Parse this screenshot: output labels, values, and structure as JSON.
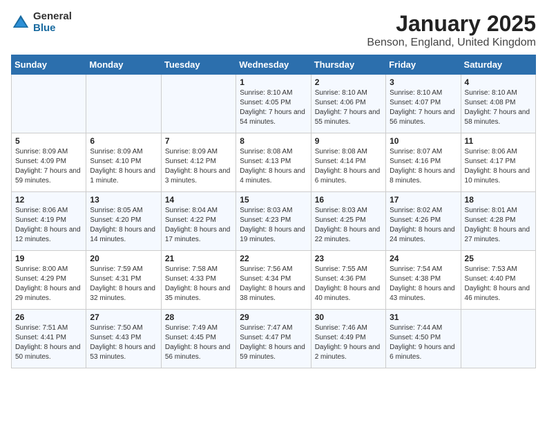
{
  "logo": {
    "general": "General",
    "blue": "Blue"
  },
  "title": "January 2025",
  "subtitle": "Benson, England, United Kingdom",
  "weekdays": [
    "Sunday",
    "Monday",
    "Tuesday",
    "Wednesday",
    "Thursday",
    "Friday",
    "Saturday"
  ],
  "weeks": [
    [
      {
        "day": "",
        "detail": ""
      },
      {
        "day": "",
        "detail": ""
      },
      {
        "day": "",
        "detail": ""
      },
      {
        "day": "1",
        "detail": "Sunrise: 8:10 AM\nSunset: 4:05 PM\nDaylight: 7 hours\nand 54 minutes."
      },
      {
        "day": "2",
        "detail": "Sunrise: 8:10 AM\nSunset: 4:06 PM\nDaylight: 7 hours\nand 55 minutes."
      },
      {
        "day": "3",
        "detail": "Sunrise: 8:10 AM\nSunset: 4:07 PM\nDaylight: 7 hours\nand 56 minutes."
      },
      {
        "day": "4",
        "detail": "Sunrise: 8:10 AM\nSunset: 4:08 PM\nDaylight: 7 hours\nand 58 minutes."
      }
    ],
    [
      {
        "day": "5",
        "detail": "Sunrise: 8:09 AM\nSunset: 4:09 PM\nDaylight: 7 hours\nand 59 minutes."
      },
      {
        "day": "6",
        "detail": "Sunrise: 8:09 AM\nSunset: 4:10 PM\nDaylight: 8 hours\nand 1 minute."
      },
      {
        "day": "7",
        "detail": "Sunrise: 8:09 AM\nSunset: 4:12 PM\nDaylight: 8 hours\nand 3 minutes."
      },
      {
        "day": "8",
        "detail": "Sunrise: 8:08 AM\nSunset: 4:13 PM\nDaylight: 8 hours\nand 4 minutes."
      },
      {
        "day": "9",
        "detail": "Sunrise: 8:08 AM\nSunset: 4:14 PM\nDaylight: 8 hours\nand 6 minutes."
      },
      {
        "day": "10",
        "detail": "Sunrise: 8:07 AM\nSunset: 4:16 PM\nDaylight: 8 hours\nand 8 minutes."
      },
      {
        "day": "11",
        "detail": "Sunrise: 8:06 AM\nSunset: 4:17 PM\nDaylight: 8 hours\nand 10 minutes."
      }
    ],
    [
      {
        "day": "12",
        "detail": "Sunrise: 8:06 AM\nSunset: 4:19 PM\nDaylight: 8 hours\nand 12 minutes."
      },
      {
        "day": "13",
        "detail": "Sunrise: 8:05 AM\nSunset: 4:20 PM\nDaylight: 8 hours\nand 14 minutes."
      },
      {
        "day": "14",
        "detail": "Sunrise: 8:04 AM\nSunset: 4:22 PM\nDaylight: 8 hours\nand 17 minutes."
      },
      {
        "day": "15",
        "detail": "Sunrise: 8:03 AM\nSunset: 4:23 PM\nDaylight: 8 hours\nand 19 minutes."
      },
      {
        "day": "16",
        "detail": "Sunrise: 8:03 AM\nSunset: 4:25 PM\nDaylight: 8 hours\nand 22 minutes."
      },
      {
        "day": "17",
        "detail": "Sunrise: 8:02 AM\nSunset: 4:26 PM\nDaylight: 8 hours\nand 24 minutes."
      },
      {
        "day": "18",
        "detail": "Sunrise: 8:01 AM\nSunset: 4:28 PM\nDaylight: 8 hours\nand 27 minutes."
      }
    ],
    [
      {
        "day": "19",
        "detail": "Sunrise: 8:00 AM\nSunset: 4:29 PM\nDaylight: 8 hours\nand 29 minutes."
      },
      {
        "day": "20",
        "detail": "Sunrise: 7:59 AM\nSunset: 4:31 PM\nDaylight: 8 hours\nand 32 minutes."
      },
      {
        "day": "21",
        "detail": "Sunrise: 7:58 AM\nSunset: 4:33 PM\nDaylight: 8 hours\nand 35 minutes."
      },
      {
        "day": "22",
        "detail": "Sunrise: 7:56 AM\nSunset: 4:34 PM\nDaylight: 8 hours\nand 38 minutes."
      },
      {
        "day": "23",
        "detail": "Sunrise: 7:55 AM\nSunset: 4:36 PM\nDaylight: 8 hours\nand 40 minutes."
      },
      {
        "day": "24",
        "detail": "Sunrise: 7:54 AM\nSunset: 4:38 PM\nDaylight: 8 hours\nand 43 minutes."
      },
      {
        "day": "25",
        "detail": "Sunrise: 7:53 AM\nSunset: 4:40 PM\nDaylight: 8 hours\nand 46 minutes."
      }
    ],
    [
      {
        "day": "26",
        "detail": "Sunrise: 7:51 AM\nSunset: 4:41 PM\nDaylight: 8 hours\nand 50 minutes."
      },
      {
        "day": "27",
        "detail": "Sunrise: 7:50 AM\nSunset: 4:43 PM\nDaylight: 8 hours\nand 53 minutes."
      },
      {
        "day": "28",
        "detail": "Sunrise: 7:49 AM\nSunset: 4:45 PM\nDaylight: 8 hours\nand 56 minutes."
      },
      {
        "day": "29",
        "detail": "Sunrise: 7:47 AM\nSunset: 4:47 PM\nDaylight: 8 hours\nand 59 minutes."
      },
      {
        "day": "30",
        "detail": "Sunrise: 7:46 AM\nSunset: 4:49 PM\nDaylight: 9 hours\nand 2 minutes."
      },
      {
        "day": "31",
        "detail": "Sunrise: 7:44 AM\nSunset: 4:50 PM\nDaylight: 9 hours\nand 6 minutes."
      },
      {
        "day": "",
        "detail": ""
      }
    ]
  ]
}
